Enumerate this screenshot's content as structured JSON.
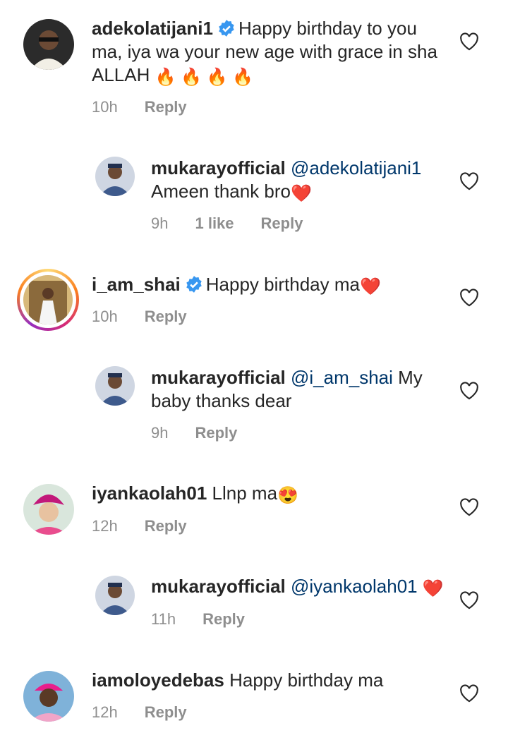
{
  "comments": [
    {
      "username": "adekolatijani1",
      "verified": true,
      "text": "Happy birthday to you ma, iya wa your new age with grace in sha ALLAH",
      "emoji": "🔥 🔥 🔥 🔥",
      "time": "10h",
      "reply_label": "Reply"
    },
    {
      "username": "mukarayofficial",
      "mention": "@adekolatijani1",
      "text": "Ameen thank bro",
      "emoji": "❤️",
      "time": "9h",
      "likes": "1 like",
      "reply_label": "Reply"
    },
    {
      "username": "i_am_shai",
      "verified": true,
      "text": "Happy birthday ma",
      "emoji": "❤️",
      "time": "10h",
      "reply_label": "Reply"
    },
    {
      "username": "mukarayofficial",
      "mention": "@i_am_shai",
      "text": "My baby thanks dear",
      "time": "9h",
      "reply_label": "Reply"
    },
    {
      "username": "iyankaolah01",
      "text": "Llnp ma",
      "emoji": "😍",
      "time": "12h",
      "reply_label": "Reply"
    },
    {
      "username": "mukarayofficial",
      "mention": "@iyankaolah01",
      "emoji": "❤️",
      "time": "11h",
      "reply_label": "Reply"
    },
    {
      "username": "iamoloyedebas",
      "text": "Happy birthday ma",
      "time": "12h",
      "reply_label": "Reply"
    }
  ],
  "colors": {
    "text": "#262626",
    "meta": "#8e8e8e",
    "mention": "#00376b",
    "verified": "#3897f0"
  },
  "icons": {
    "like": "heart-outline-icon",
    "verified": "verified-badge-icon"
  }
}
